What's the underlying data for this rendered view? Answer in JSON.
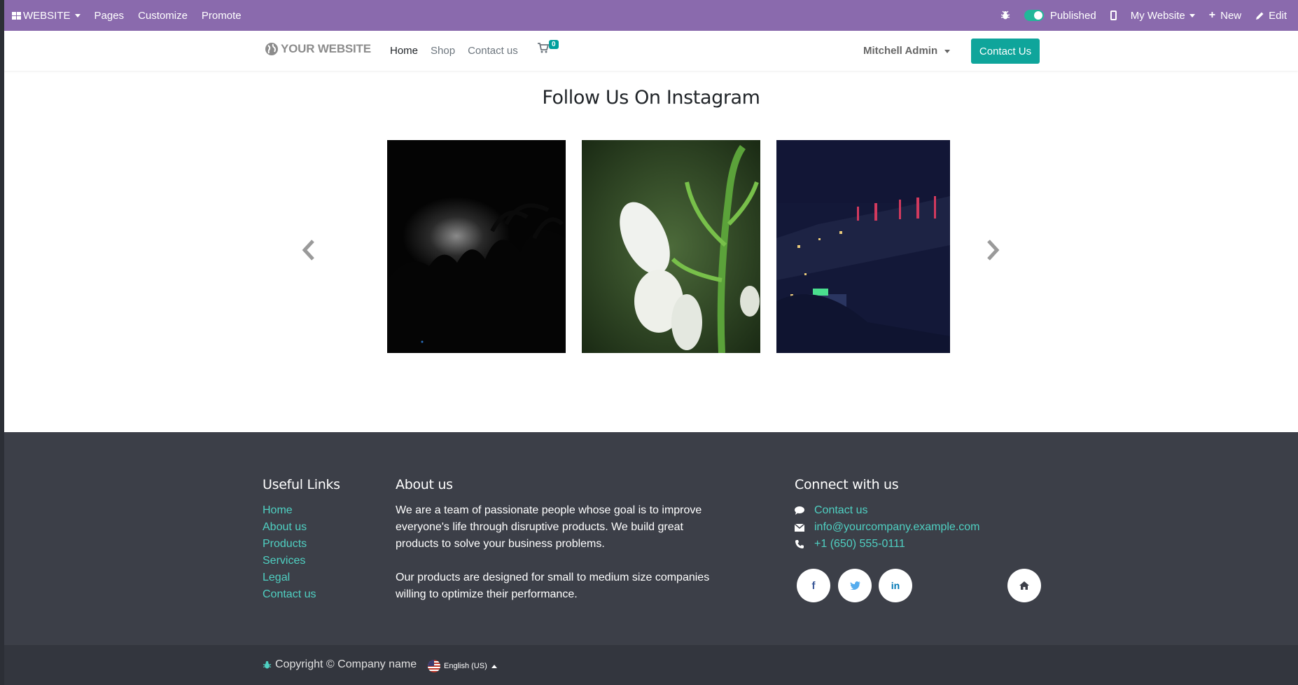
{
  "admin_bar": {
    "apps_label": "WEBSITE",
    "menu": [
      "Pages",
      "Customize",
      "Promote"
    ],
    "published_label": "Published",
    "website_label": "My Website",
    "new_label": "New",
    "edit_label": "Edit",
    "published": true
  },
  "header": {
    "logo_text": "YOUR WEBSITE",
    "nav": [
      "Home",
      "Shop",
      "Contact us"
    ],
    "active_nav": "Home",
    "cart_count": "0",
    "user_name": "Mitchell Admin",
    "cta_label": "Contact Us"
  },
  "instagram": {
    "title": "Follow Us On Instagram",
    "photos": [
      "night-palm-trees",
      "white-flower",
      "city-night-lights"
    ]
  },
  "footer": {
    "useful_links_title": "Useful Links",
    "useful_links": [
      "Home",
      "About us",
      "Products",
      "Services",
      "Legal",
      "Contact us"
    ],
    "about_title": "About us",
    "about_p1": "We are a team of passionate people whose goal is to improve everyone's life through disruptive products. We build great products to solve your business problems.",
    "about_p2": "Our products are designed for small to medium size companies willing to optimize their performance.",
    "connect_title": "Connect with us",
    "contact_link": "Contact us",
    "email": "info@yourcompany.example.com",
    "phone": "+1 (650) 555-0111",
    "social": [
      "facebook-icon",
      "twitter-icon",
      "linkedin-icon",
      "home-icon"
    ]
  },
  "copyright": {
    "text": "Copyright © Company name",
    "language": "English (US)"
  },
  "colors": {
    "admin_bar": "#8a6aad",
    "accent": "#0fa59b",
    "footer_link": "#4fd0c2",
    "footer_bg": "#3c3f48",
    "copyright_bg": "#33363e"
  }
}
